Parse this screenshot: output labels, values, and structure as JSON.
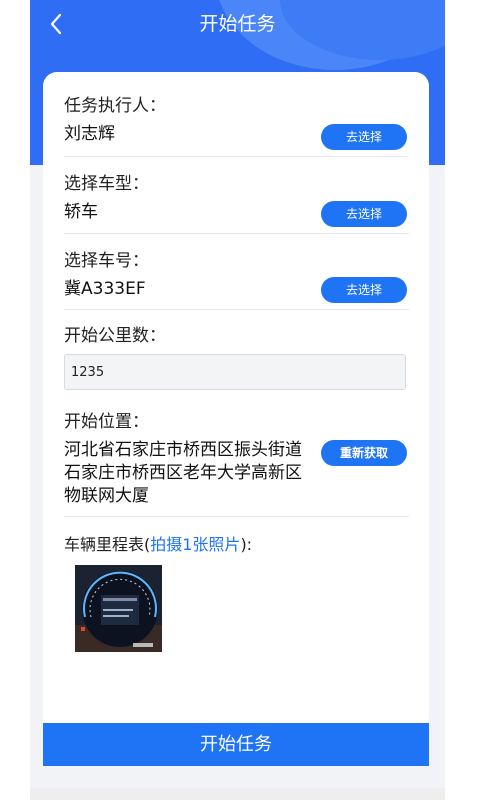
{
  "header": {
    "title": "开始任务",
    "back_icon": "chevron-left-icon"
  },
  "executor": {
    "label": "任务执行人：",
    "value": "刘志辉",
    "button": "去选择"
  },
  "vehicle_type": {
    "label": "选择车型：",
    "value": "轿车",
    "button": "去选择"
  },
  "vehicle_number": {
    "label": "选择车号：",
    "value": "冀A333EF",
    "button": "去选择"
  },
  "start_mileage": {
    "label": "开始公里数：",
    "value": "1235"
  },
  "start_location": {
    "label": "开始位置：",
    "lines": [
      "河北省石家庄市桥西区振头街道",
      "石家庄市桥西区老年大学高新区",
      "物联网大厦"
    ],
    "button": "重新获取"
  },
  "odometer": {
    "label_prefix": "车辆里程表(",
    "label_link": "拍摄1张照片",
    "label_suffix": "):"
  },
  "footer": {
    "start_button": "开始任务"
  },
  "colors": {
    "primary": "#1f74f5",
    "header": "#2f6df4"
  }
}
